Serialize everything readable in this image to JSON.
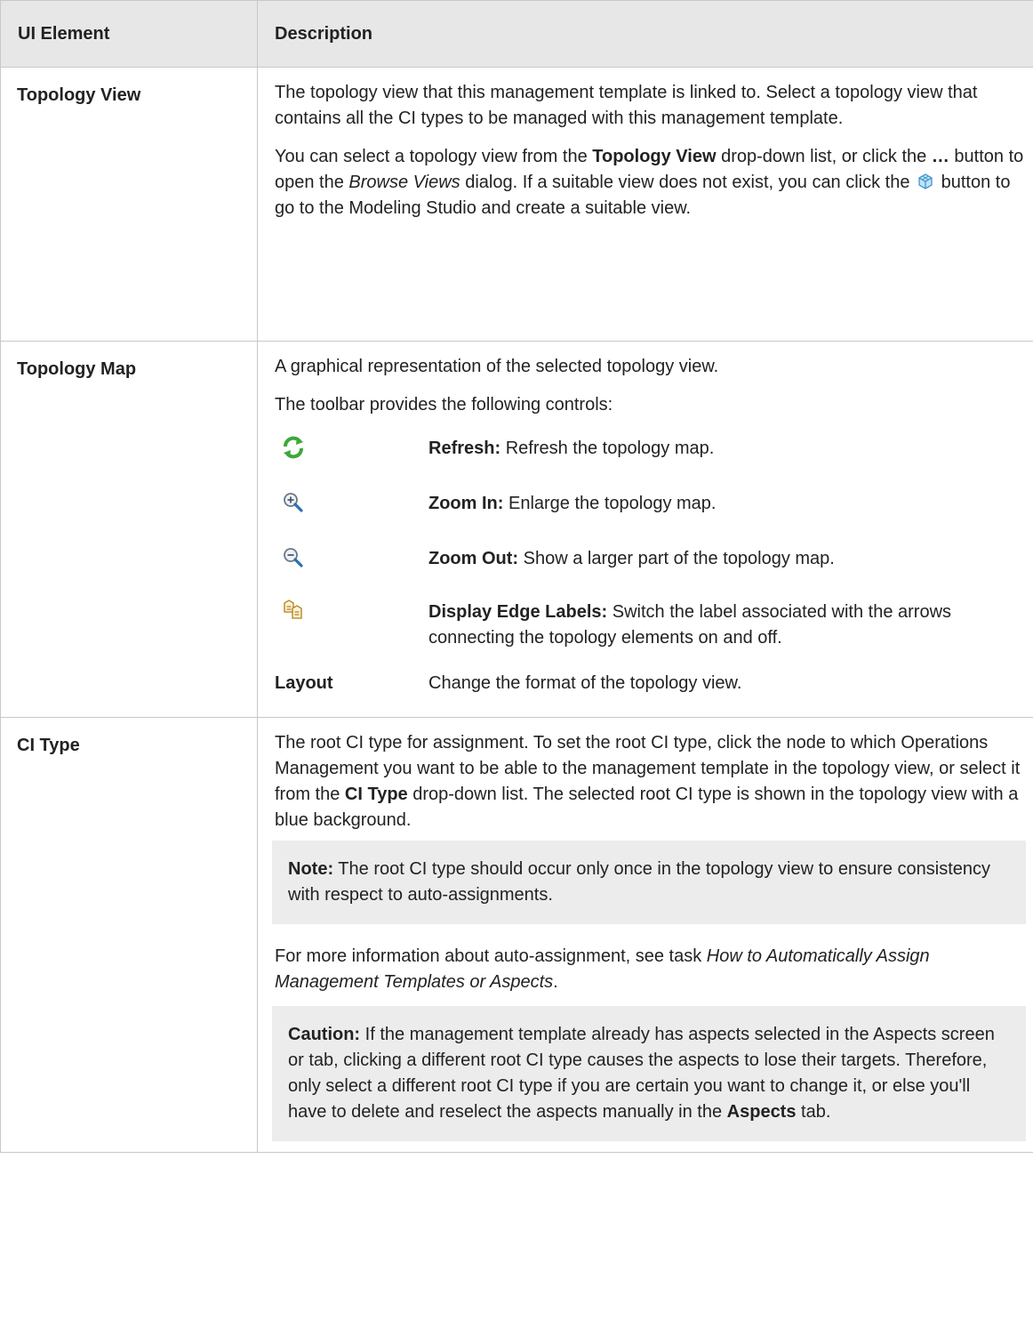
{
  "header": {
    "col1": "UI Element",
    "col2": "Description"
  },
  "rows": {
    "topology_view": {
      "name": "Topology View",
      "p1": "The topology view that this management template is linked to. Select a topology view that contains all the CI types to be managed with this management template.",
      "p2_a": "You can select a topology view from the ",
      "p2_b": "Topology View",
      "p2_c": " drop-down list, or click the ",
      "p2_d": "…",
      "p2_e": " button to open the ",
      "p2_f": "Browse Views",
      "p2_g": " dialog. If a suitable view does not exist, you can click the ",
      "p2_icon": "modeling-studio-icon",
      "p2_h": " button to go to the Modeling Studio and create a suitable view."
    },
    "topology_map": {
      "name": "Topology Map",
      "p1": "A graphical representation of the selected topology view.",
      "p2": "The toolbar provides the following controls:",
      "controls": [
        {
          "icon": "refresh-icon",
          "label": "Refresh:",
          "text": " Refresh the topology map."
        },
        {
          "icon": "zoom-in-icon",
          "label": "Zoom In:",
          "text": " Enlarge the topology map."
        },
        {
          "icon": "zoom-out-icon",
          "label": "Zoom Out:",
          "text": " Show a larger part of the topology map."
        },
        {
          "icon": "edge-labels-icon",
          "label": "Display Edge Labels:",
          "text": " Switch the label associated with the arrows connecting the topology elements on and off."
        },
        {
          "name": "Layout",
          "text": "Change the format of the topology view."
        }
      ]
    },
    "ci_type": {
      "name": "CI Type",
      "p1_a": "The root CI type for assignment. To set the root CI type, click the node to which Operations Management you want to be able to the management template in the topology view, or select it from the ",
      "p1_b": "CI Type",
      "p1_c": " drop-down list. The selected root CI type is shown in the topology view with a blue background.",
      "note_label": "Note:",
      "note_text": " The root CI type should occur only once in the topology view to ensure consistency with respect to auto-assignments.",
      "p2_a": "For more information about auto-assignment, see task ",
      "p2_b": "How to Automatically Assign Management Templates or Aspects",
      "p2_c": ".",
      "caution_label": "Caution:",
      "caution_text": " If the management template already has aspects selected in the Aspects screen or tab, clicking a different root CI type causes the aspects to lose their targets. Therefore, only select a different root CI type if you are certain you want to change it, or else you'll have to delete and reselect the aspects manually in the ",
      "caution_b": "Aspects",
      "caution_c": " tab."
    }
  },
  "colors": {
    "header_bg": "#e7e7e7",
    "note_bg": "#ececec",
    "border": "#c8c8c8",
    "text": "#222222"
  }
}
